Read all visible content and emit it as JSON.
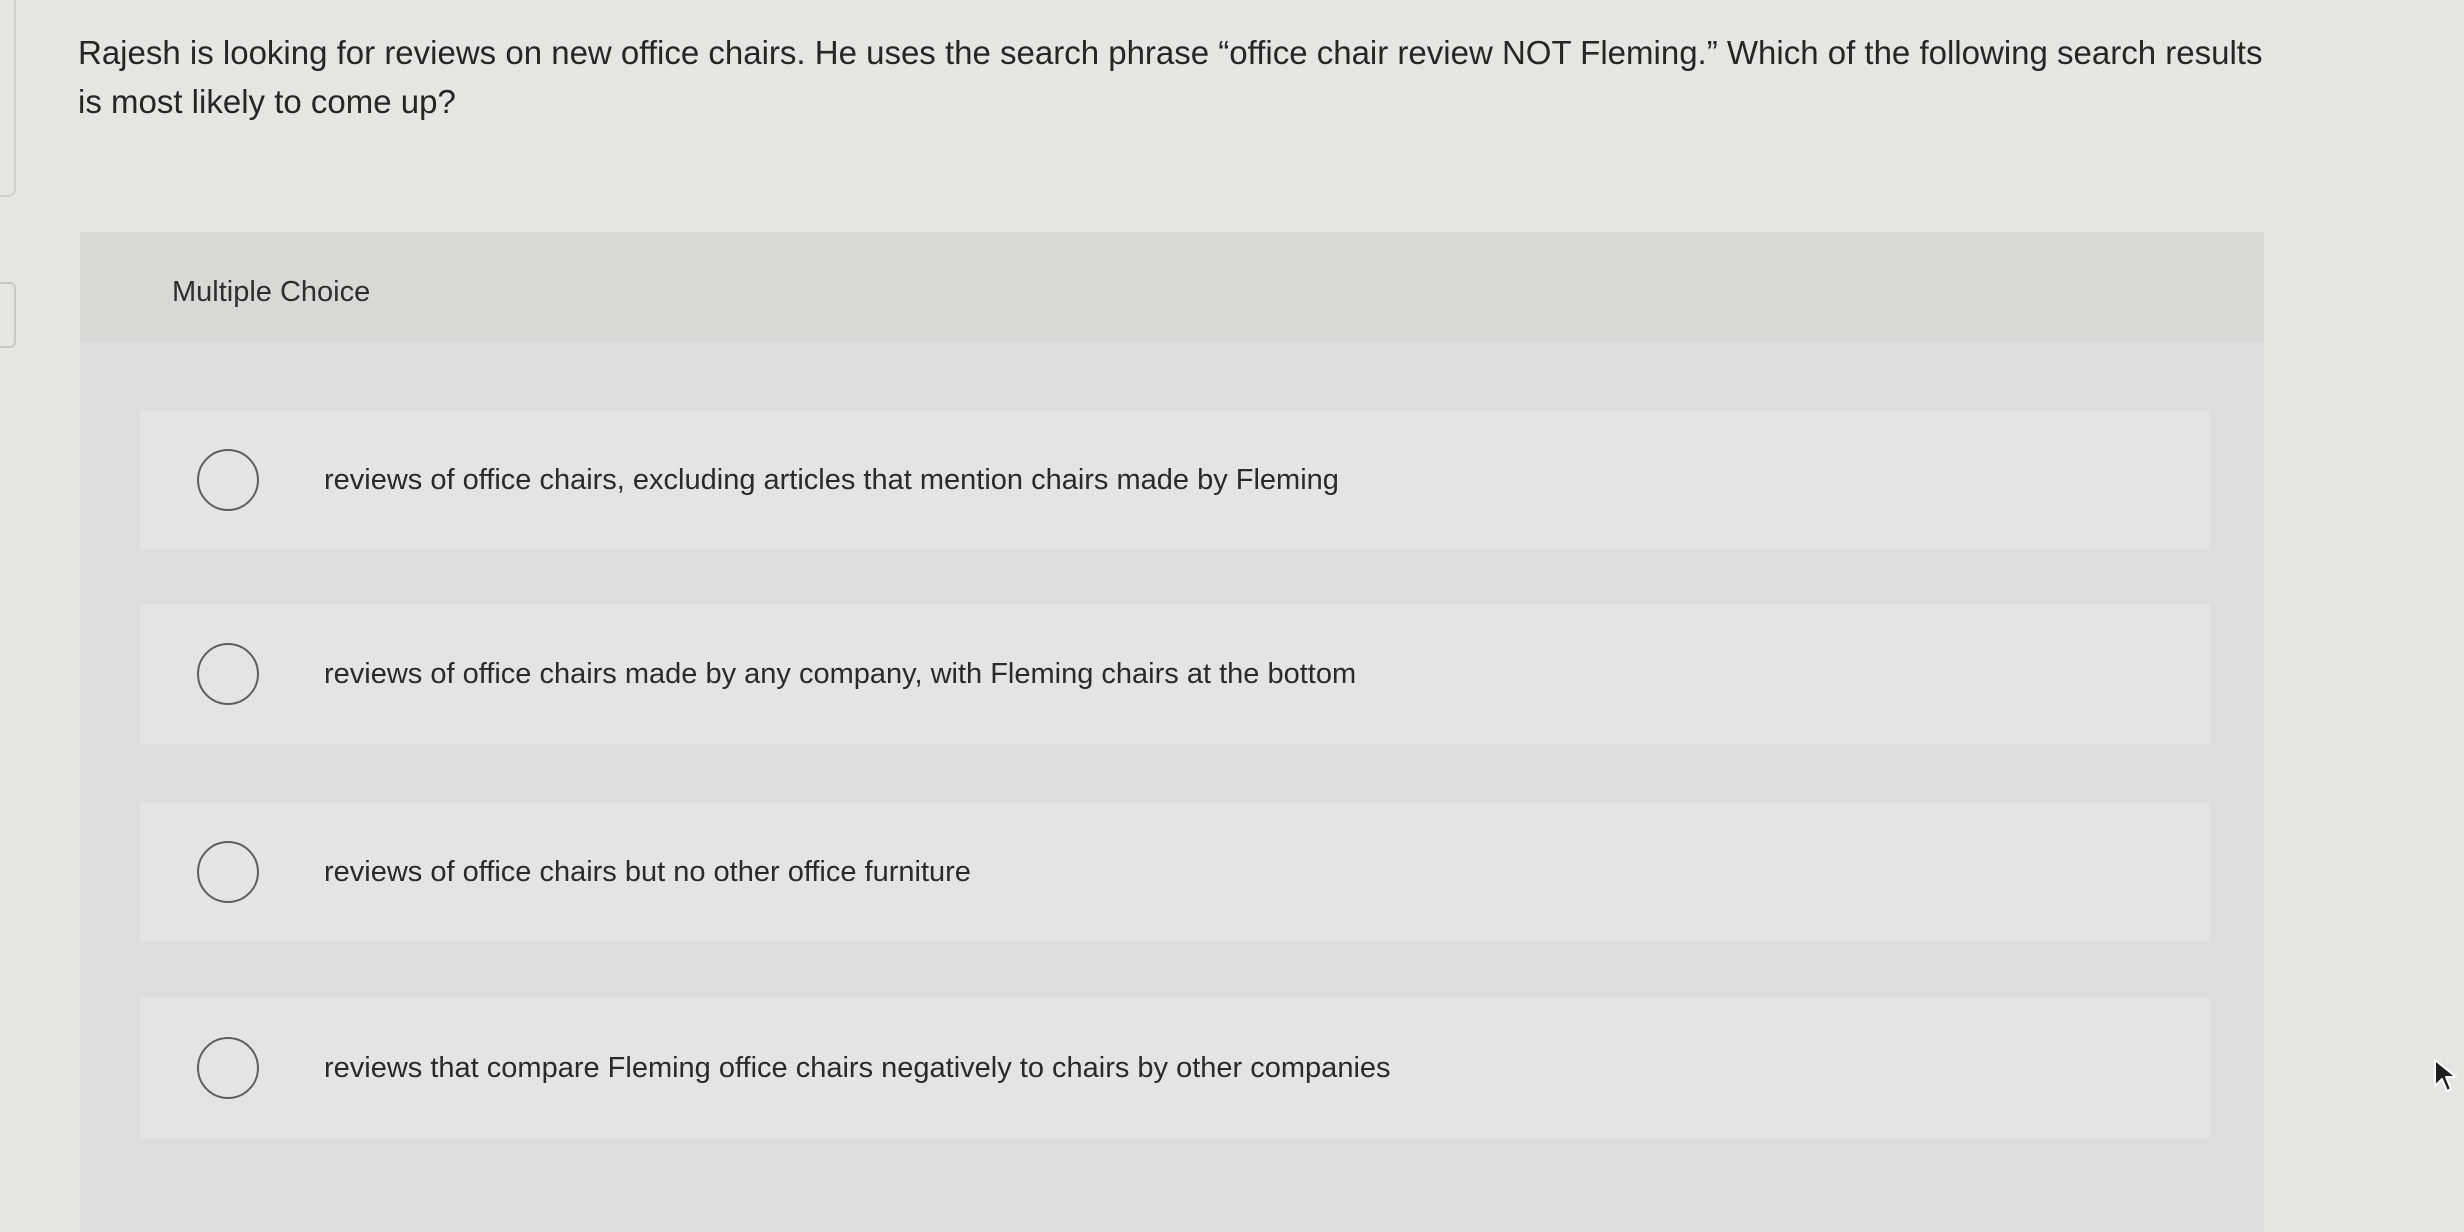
{
  "question": {
    "text": "Rajesh is looking for reviews on new office chairs. He uses the search phrase “office chair review NOT Fleming.” Which of the following search results is most likely to come up?"
  },
  "panel": {
    "label": "Multiple Choice"
  },
  "options": [
    {
      "label": "reviews of office chairs, excluding articles that mention chairs made by Fleming",
      "selected": false
    },
    {
      "label": "reviews of office chairs made by any company, with Fleming chairs at the bottom",
      "selected": false
    },
    {
      "label": "reviews of office chairs but no other office furniture",
      "selected": false
    },
    {
      "label": "reviews that compare Fleming office chairs negatively to chairs by other companies",
      "selected": false
    }
  ],
  "icons": {
    "radio": "radio-circle-icon",
    "cursor": "mouse-pointer-icon"
  }
}
